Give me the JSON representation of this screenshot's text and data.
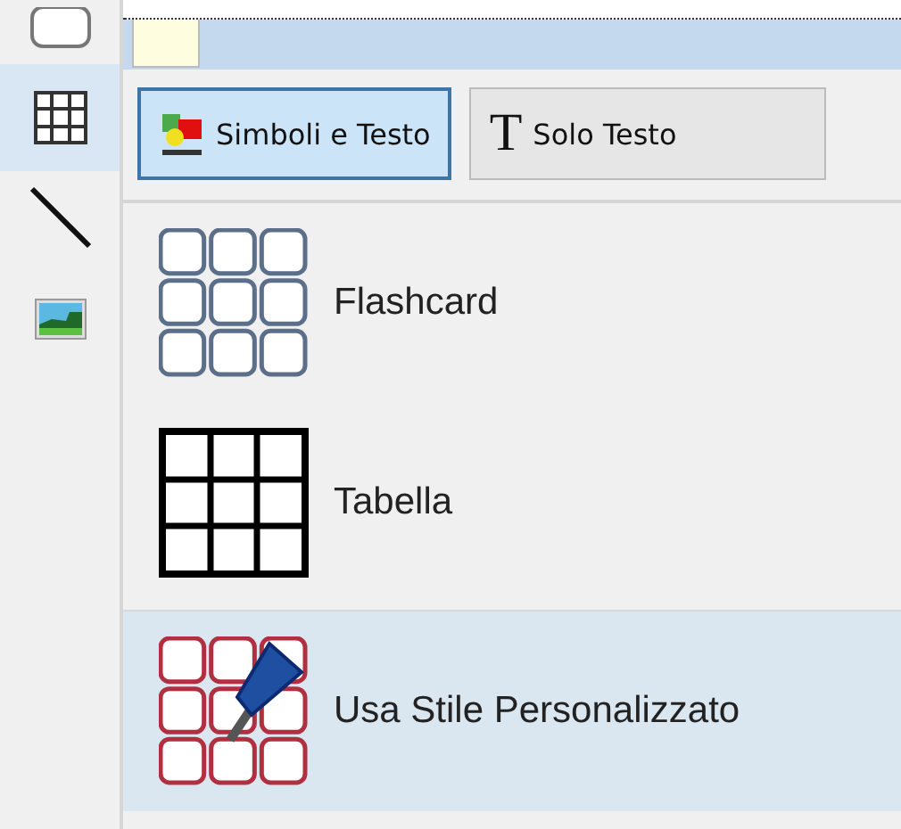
{
  "toolbar": {
    "tools": [
      {
        "kind": "shape",
        "selected": false
      },
      {
        "kind": "table",
        "selected": true
      },
      {
        "kind": "line",
        "selected": false
      },
      {
        "kind": "image",
        "selected": false
      }
    ]
  },
  "tabs": [
    {
      "kind": "symbols",
      "label": "Simboli e Testo",
      "selected": true
    },
    {
      "kind": "text",
      "glyph": "T",
      "label": "Solo Testo",
      "selected": false
    }
  ],
  "layouts": [
    {
      "kind": "flashcard",
      "label": "Flashcard",
      "selected": false
    },
    {
      "kind": "table",
      "label": "Tabella",
      "selected": false
    },
    {
      "kind": "custom",
      "label": "Usa Stile Personalizzato",
      "selected": true
    }
  ]
}
